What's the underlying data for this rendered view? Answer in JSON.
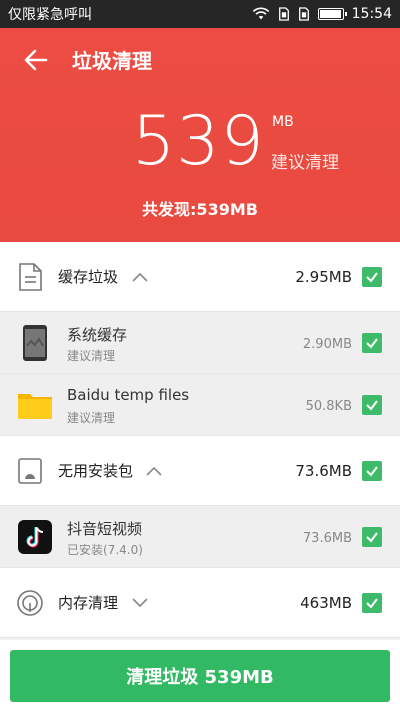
{
  "status_bar": {
    "carrier": "仅限紧急呼叫",
    "time": "15:54",
    "icons": [
      "wifi-icon",
      "sim1-icon",
      "sim2-icon",
      "battery-icon"
    ]
  },
  "header": {
    "title": "垃圾清理",
    "total_number": "539",
    "unit": "MB",
    "suggest": "建议清理",
    "found_text": "共发现:539MB",
    "background_color": "#e94a3f"
  },
  "sections": [
    {
      "title": "缓存垃圾",
      "size": "2.95MB",
      "icon": "document-icon",
      "expanded": true,
      "items": [
        {
          "name": "系统缓存",
          "sub": "建议清理",
          "size": "2.90MB",
          "icon": "phone-icon",
          "checked": true
        },
        {
          "name": "Baidu temp files",
          "sub": "建议清理",
          "size": "50.8KB",
          "icon": "folder-icon",
          "checked": true
        }
      ]
    },
    {
      "title": "无用安装包",
      "size": "73.6MB",
      "icon": "apk-package-icon",
      "expanded": true,
      "items": [
        {
          "name": "抖音短视频",
          "sub": "已安装(7.4.0)",
          "size": "73.6MB",
          "icon": "tiktok-icon",
          "checked": true
        }
      ]
    },
    {
      "title": "内存清理",
      "size": "463MB",
      "icon": "memory-gauge-icon",
      "expanded": false,
      "items": []
    }
  ],
  "bottom": {
    "clean_button": "清理垃圾 539MB",
    "button_color": "#31b963"
  },
  "accent_check_color": "#3dbb6b"
}
